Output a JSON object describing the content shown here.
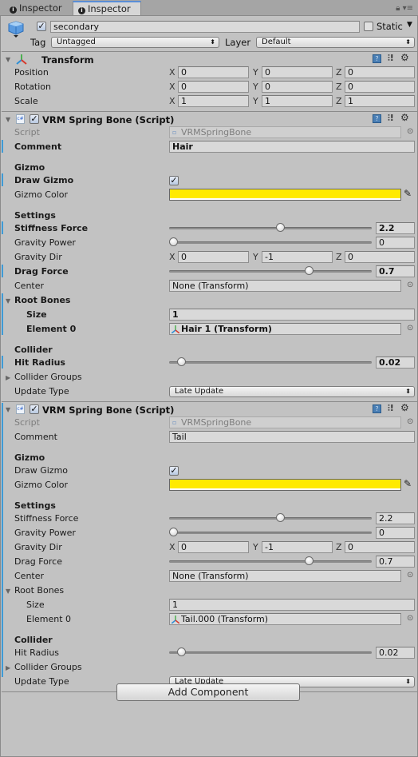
{
  "tabs": [
    {
      "label": "Inspector",
      "active": false
    },
    {
      "label": "Inspector",
      "active": true
    }
  ],
  "tab_bar_icons": [
    "lock-icon",
    "menu-icon"
  ],
  "gameobject": {
    "active": true,
    "name": "secondary",
    "static_label": "Static",
    "static_checked": false,
    "tag_label": "Tag",
    "tag_value": "Untagged",
    "layer_label": "Layer",
    "layer_value": "Default"
  },
  "transform": {
    "title": "Transform",
    "rows": [
      {
        "label": "Position",
        "x": "0",
        "y": "0",
        "z": "0"
      },
      {
        "label": "Rotation",
        "x": "0",
        "y": "0",
        "z": "0"
      },
      {
        "label": "Scale",
        "x": "1",
        "y": "1",
        "z": "1"
      }
    ]
  },
  "axes": {
    "x": "X",
    "y": "Y",
    "z": "Z"
  },
  "components": [
    {
      "title": "VRM Spring Bone (Script)",
      "enabled": true,
      "script_label": "Script",
      "script_value": "VRMSpringBone",
      "comment_label": "Comment",
      "comment_value": "Hair",
      "gizmo_header": "Gizmo",
      "draw_gizmo_label": "Draw Gizmo",
      "draw_gizmo_checked": true,
      "gizmo_color_label": "Gizmo Color",
      "gizmo_color": "#ffea00",
      "settings_header": "Settings",
      "stiffness_label": "Stiffness Force",
      "stiffness_value": "2.2",
      "stiffness_fraction": 0.55,
      "gravity_power_label": "Gravity Power",
      "gravity_power_value": "0",
      "gravity_power_fraction": 0.0,
      "gravity_dir_label": "Gravity Dir",
      "gravity_dir": {
        "x": "0",
        "y": "-1",
        "z": "0"
      },
      "drag_label": "Drag Force",
      "drag_value": "0.7",
      "drag_fraction": 0.7,
      "center_label": "Center",
      "center_value": "None (Transform)",
      "root_bones_label": "Root Bones",
      "size_label": "Size",
      "size_value": "1",
      "element0_label": "Element 0",
      "element0_value": "Hair 1 (Transform)",
      "collider_header": "Collider",
      "hit_radius_label": "Hit Radius",
      "hit_radius_value": "0.02",
      "hit_radius_fraction": 0.04,
      "collider_groups_label": "Collider Groups",
      "update_type_label": "Update Type",
      "update_type_value": "Late Update"
    },
    {
      "title": "VRM Spring Bone (Script)",
      "enabled": true,
      "script_label": "Script",
      "script_value": "VRMSpringBone",
      "comment_label": "Comment",
      "comment_value": "Tail",
      "gizmo_header": "Gizmo",
      "draw_gizmo_label": "Draw Gizmo",
      "draw_gizmo_checked": true,
      "gizmo_color_label": "Gizmo Color",
      "gizmo_color": "#ffea00",
      "settings_header": "Settings",
      "stiffness_label": "Stiffness Force",
      "stiffness_value": "2.2",
      "stiffness_fraction": 0.55,
      "gravity_power_label": "Gravity Power",
      "gravity_power_value": "0",
      "gravity_power_fraction": 0.0,
      "gravity_dir_label": "Gravity Dir",
      "gravity_dir": {
        "x": "0",
        "y": "-1",
        "z": "0"
      },
      "drag_label": "Drag Force",
      "drag_value": "0.7",
      "drag_fraction": 0.7,
      "center_label": "Center",
      "center_value": "None (Transform)",
      "root_bones_label": "Root Bones",
      "size_label": "Size",
      "size_value": "1",
      "element0_label": "Element 0",
      "element0_value": "Tail.000 (Transform)",
      "collider_header": "Collider",
      "hit_radius_label": "Hit Radius",
      "hit_radius_value": "0.02",
      "hit_radius_fraction": 0.04,
      "collider_groups_label": "Collider Groups",
      "update_type_label": "Update Type",
      "update_type_value": "Late Update"
    }
  ],
  "add_component_label": "Add Component",
  "colors": {
    "accent_blue": "#3d9ad6",
    "gizmo_yellow": "#ffea00",
    "panel_bg": "#c2c2c2"
  }
}
